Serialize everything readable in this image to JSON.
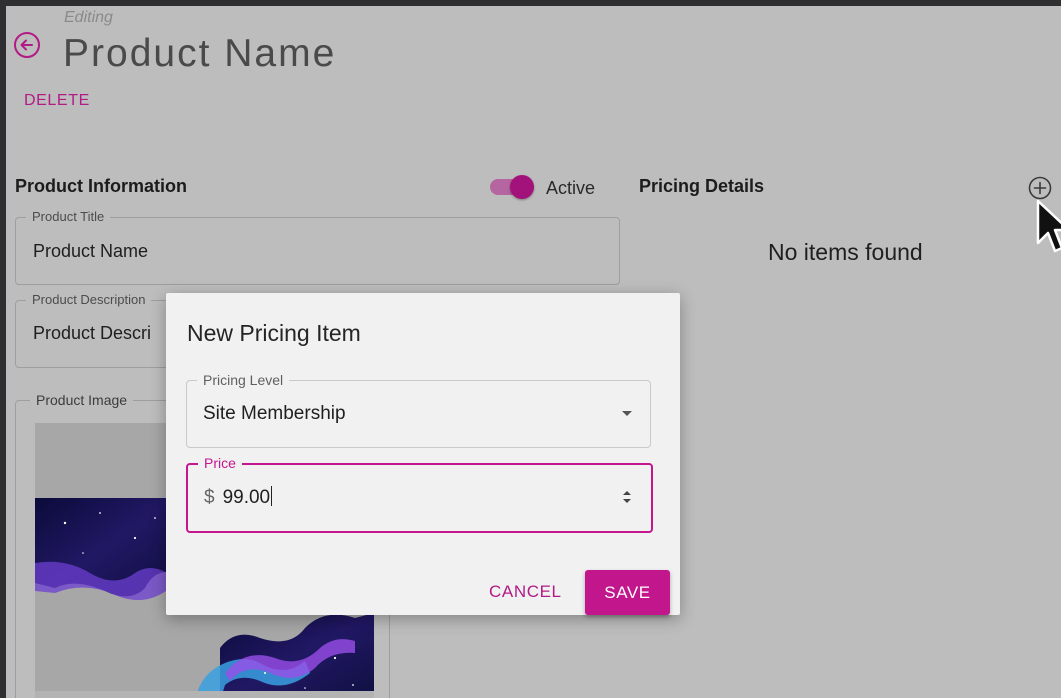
{
  "header": {
    "editing_label": "Editing",
    "title": "Product Name",
    "delete_label": "DELETE"
  },
  "product_info": {
    "section_title": "Product Information",
    "active_label": "Active",
    "active": true,
    "title_field": {
      "label": "Product Title",
      "value": "Product Name"
    },
    "description_field": {
      "label": "Product Description",
      "value": "Product Descri"
    },
    "image_field": {
      "label": "Product Image"
    }
  },
  "pricing": {
    "section_title": "Pricing Details",
    "empty_text": "No items found"
  },
  "dialog": {
    "title": "New Pricing Item",
    "pricing_level": {
      "label": "Pricing Level",
      "value": "Site Membership"
    },
    "price": {
      "label": "Price",
      "currency": "$",
      "value": "99.00"
    },
    "cancel_label": "CANCEL",
    "save_label": "SAVE"
  },
  "colors": {
    "accent": "#c1168c",
    "backdrop": "#bdbdbd",
    "dialog_bg": "#f1f1f1"
  }
}
